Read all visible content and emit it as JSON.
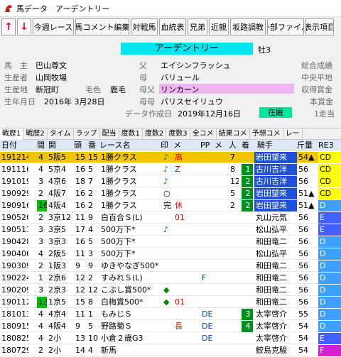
{
  "window": {
    "title": "馬データ　アーデントリー",
    "icon": "horse-app-icon"
  },
  "toolbar": {
    "up": "↑",
    "down": "↓",
    "buttons": [
      "今週レース",
      "馬コメント編集",
      "対戦馬",
      "血統表",
      "兄弟",
      "近親",
      "坂路調教",
      "外部ファイル",
      "表示項目"
    ]
  },
  "horse": {
    "name": "アーデントリー",
    "sex_age": "牡3",
    "owner_label": "馬　主",
    "owner": "巴山尊文",
    "breeder_label": "生産者",
    "breeder": "山岡牧場",
    "origin_label": "生産地",
    "origin": "新冠町",
    "color_label": "毛色",
    "color": "鹿毛",
    "birth_label": "生年月日",
    "birth": "2016年 3月28日",
    "sire_label": "父",
    "sire": "エイシンフラッシュ",
    "dam_label": "母",
    "dam": "バリュール",
    "damsire_label": "母父",
    "damsire": "リンカーン",
    "damdam_label": "母母",
    "damdam": "パリスセイリュウ",
    "created_label": "データ作成日",
    "created": "2019年12月16日",
    "status": "在厩",
    "right_labels": [
      "総合成績",
      "中央平地",
      "収得賞金",
      "本賞金",
      "1走当"
    ]
  },
  "tabs": [
    "戦歴1",
    "戦歴2",
    "タイム",
    "ラップ",
    "配当",
    "度数1",
    "度数2",
    "度数3",
    "全コメ",
    "結果コメ",
    "予想コメ",
    "レー"
  ],
  "table": {
    "headers": [
      "日付",
      "間",
      "開",
      "頭",
      "番",
      "レース名",
      "印",
      "メ",
      "PP",
      "メ",
      "人",
      "着",
      "騎手",
      "斤量",
      "RE3"
    ],
    "rows": [
      [
        "191214",
        "4",
        "5阪5",
        "15",
        "15",
        "1勝クラス",
        "♪",
        "高",
        "",
        "",
        "7",
        "",
        "岩田望来",
        "54▲",
        "CD",
        true
      ],
      [
        "191116",
        "4",
        "5京4",
        "16",
        "5",
        "1勝クラス",
        "♪",
        "Z",
        "",
        "",
        "8",
        "1",
        "古川吉洋",
        "56",
        "CD",
        false
      ],
      [
        "191019",
        "3",
        "4京6",
        "18",
        "7",
        "1勝クラス",
        "♪",
        "",
        "",
        "",
        "12",
        "2",
        "古川吉洋",
        "56",
        "CD",
        false
      ],
      [
        "190929",
        "2",
        "4阪7",
        "16",
        "2",
        "1勝クラス",
        "○",
        "",
        "",
        "",
        "5",
        "2",
        "岩田望来",
        "51▲",
        "CD",
        false
      ],
      [
        "190916",
        "16",
        "4阪4",
        "16",
        "2",
        "1勝クラス",
        "完",
        "休",
        "",
        "",
        "2",
        "2",
        "岩田望来",
        "51▲",
        "D",
        false
      ],
      [
        "190526",
        "2",
        "3京12",
        "11",
        "9",
        "白百合Ｓ(L)",
        "",
        "01",
        "",
        "",
        "",
        "",
        "丸山元気",
        "56",
        "E",
        false
      ],
      [
        "190511",
        "3",
        "3京5",
        "17",
        "4",
        "500万下*",
        "♪",
        "",
        "",
        "",
        "",
        "",
        "松山弘平",
        "56",
        "E",
        false
      ],
      [
        "190428",
        "3",
        "3京3",
        "16",
        "5",
        "500万下*",
        "",
        "",
        "",
        "",
        "",
        "",
        "和田竜二",
        "56",
        "D",
        false
      ],
      [
        "190406",
        "4",
        "2阪5",
        "11",
        "3",
        "500万下*",
        "",
        "",
        "",
        "",
        "",
        "",
        "松山弘平",
        "56",
        "D",
        false
      ],
      [
        "190309",
        "2",
        "1阪3",
        "9",
        "9",
        "ゆきやなぎ500*",
        "",
        "",
        "",
        "",
        "",
        "",
        "和田竜二",
        "56",
        "D",
        false
      ],
      [
        "190224",
        "1",
        "2京6",
        "12",
        "2",
        "すみれＳ(L)",
        "",
        "",
        "F",
        "",
        "",
        "",
        "和田竜二",
        "56",
        "D",
        false
      ],
      [
        "190209",
        "3",
        "2京3",
        "12",
        "12",
        "こぶし賞500*",
        "◆",
        "",
        "",
        "",
        "",
        "",
        "和田竜二",
        "56",
        "D",
        false
      ],
      [
        "190112",
        "13",
        "1京5",
        "15",
        "8",
        "白梅賞500*",
        "◆",
        "01",
        "",
        "",
        "",
        "",
        "和田竜二",
        "56",
        "D",
        false
      ],
      [
        "181013",
        "4",
        "4京4",
        "11",
        "1",
        "もみじＳ",
        "",
        "",
        "DE",
        "",
        "",
        "3",
        "太宰啓介",
        "55",
        "D",
        false
      ],
      [
        "180915",
        "4",
        "4阪4",
        "9",
        "5",
        "野路菊Ｓ",
        "",
        "長",
        "DE",
        "",
        "",
        "4",
        "太宰啓介",
        "54",
        "D",
        false
      ],
      [
        "180825",
        "4",
        "2小",
        "13",
        "10",
        "小倉２歳G3",
        "",
        "",
        "DE",
        "",
        "",
        "",
        "太宰啓介",
        "54",
        "E",
        false
      ],
      [
        "180729",
        "2",
        "2小",
        "14",
        "4",
        "新馬",
        "",
        "",
        "",
        "",
        "",
        "",
        "鮫島克駿",
        "54",
        "F",
        false
      ]
    ]
  },
  "colors": {
    "name_bg": "#00e6f0",
    "mother_bg": "#f0b4f0",
    "status_bg": "#00e6a0",
    "sel_row": "#f5c400",
    "header_bg": "#dce6f5"
  }
}
